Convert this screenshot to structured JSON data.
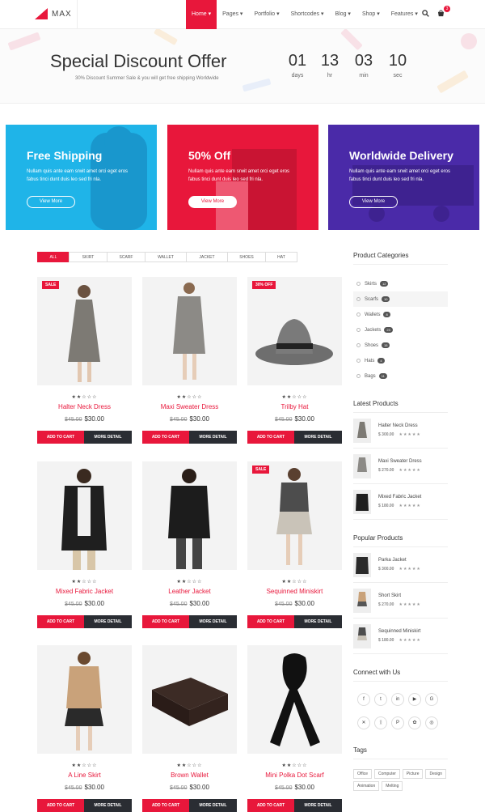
{
  "header": {
    "logo_mark": "I",
    "logo_text": "MAX",
    "nav": [
      {
        "label": "Home ▾",
        "active": true
      },
      {
        "label": "Pages ▾"
      },
      {
        "label": "Portfolio ▾"
      },
      {
        "label": "Shortcodes ▾"
      },
      {
        "label": "Blog ▾"
      },
      {
        "label": "Shop ▾"
      },
      {
        "label": "Features ▾"
      }
    ],
    "search_icon": "search-icon",
    "cart_icon": "cart-icon",
    "cart_count": "3"
  },
  "banner": {
    "title": "Special Discount Offer",
    "subtitle": "30% Discount Summer Sale & you will get free shipping Worldwide",
    "countdown": [
      {
        "value": "01",
        "label": "days"
      },
      {
        "value": "13",
        "label": "hr"
      },
      {
        "value": "03",
        "label": "min"
      },
      {
        "value": "10",
        "label": "sec"
      }
    ]
  },
  "promos": [
    {
      "title": "Free Shipping",
      "text": "Nullam quis ante eam srwit amet orci eget eros fabus tinci dunt duis leo sed fri nla.",
      "button": "View More",
      "color": "#1fb4e8"
    },
    {
      "title": "50% Off",
      "text": "Nullam quis ante eam srwit amet orci eget eros fabus tinci dunt duis leo sed fri nla.",
      "button": "View More",
      "color": "#e8173b"
    },
    {
      "title": "Worldwide Delivery",
      "text": "Nullam quis ante eam srwit amet orci eget eros fabus tinci dunt duis leo sed fri nla.",
      "button": "View More",
      "color": "#4a2aa8"
    }
  ],
  "filters": [
    "ALL",
    "SKIRT",
    "SCARF",
    "WALLET",
    "JACKET",
    "SHOES",
    "HAT"
  ],
  "product_buttons": {
    "cart": "ADD TO CART",
    "more": "MORE DETAIL"
  },
  "products": [
    {
      "name": "Halter Neck Dress",
      "old": "$45.00",
      "price": "$30.00",
      "badge": "SALE",
      "stars": "★★☆☆☆"
    },
    {
      "name": "Maxi Sweater Dress",
      "old": "$45.00",
      "price": "$30.00",
      "badge": "",
      "stars": "★★☆☆☆"
    },
    {
      "name": "Trilby Hat",
      "old": "$45.00",
      "price": "$30.00",
      "badge": "30% OFF",
      "stars": "★★☆☆☆"
    },
    {
      "name": "Mixed Fabric Jacket",
      "old": "$45.00",
      "price": "$30.00",
      "badge": "",
      "stars": "★★☆☆☆"
    },
    {
      "name": "Leather Jacket",
      "old": "$45.00",
      "price": "$30.00",
      "badge": "",
      "stars": "★★☆☆☆"
    },
    {
      "name": "Sequinned Miniskirt",
      "old": "$45.00",
      "price": "$30.00",
      "badge": "SALE",
      "stars": "★★☆☆☆"
    },
    {
      "name": "A Line Skirt",
      "old": "$45.00",
      "price": "$30.00",
      "badge": "",
      "stars": "★★☆☆☆"
    },
    {
      "name": "Brown Wallet",
      "old": "$45.00",
      "price": "$30.00",
      "badge": "",
      "stars": "★★☆☆☆"
    },
    {
      "name": "Mini Polka Dot Scarf",
      "old": "$45.00",
      "price": "$30.00",
      "badge": "",
      "stars": "★★☆☆☆"
    }
  ],
  "sidebar": {
    "categories_title": "Product Categories",
    "categories": [
      {
        "name": "Skirts",
        "count": "12"
      },
      {
        "name": "Scarfs",
        "count": "10"
      },
      {
        "name": "Wallets",
        "count": "8"
      },
      {
        "name": "Jackets",
        "count": "23"
      },
      {
        "name": "Shoes",
        "count": "15"
      },
      {
        "name": "Hats",
        "count": "4"
      },
      {
        "name": "Bags",
        "count": "11"
      }
    ],
    "latest_title": "Latest Products",
    "latest": [
      {
        "name": "Halter Neck Dress",
        "price": "$ 300.00",
        "stars": "★★★★★"
      },
      {
        "name": "Maxi Sweater Dress",
        "price": "$ 270.00",
        "stars": "★★★★★"
      },
      {
        "name": "Mixed Fabric Jacket",
        "price": "$ 180.00",
        "stars": "★★★★★"
      }
    ],
    "popular_title": "Popular Products",
    "popular": [
      {
        "name": "Parka Jacket",
        "price": "$ 300.00",
        "stars": "★★★★★"
      },
      {
        "name": "Short Skirt",
        "price": "$ 270.00",
        "stars": "★★★★★"
      },
      {
        "name": "Sequinned Miniskirt",
        "price": "$ 180.00",
        "stars": "★★★★★"
      }
    ],
    "connect_title": "Connect with Us",
    "socials": [
      "f",
      "t",
      "in",
      "▶",
      "G",
      "✕",
      "ᛝ",
      "P",
      "✿",
      "◎"
    ],
    "social_icons": [
      "facebook-icon",
      "twitter-icon",
      "linkedin-icon",
      "youtube-icon",
      "google-plus-icon",
      "xing-icon",
      "vk-icon",
      "pinterest-icon",
      "dribbble-icon",
      "weibo-icon"
    ],
    "tags_title": "Tags",
    "tags": [
      "Office",
      "Computer",
      "Picture",
      "Design",
      "Animation",
      "Melting"
    ]
  }
}
